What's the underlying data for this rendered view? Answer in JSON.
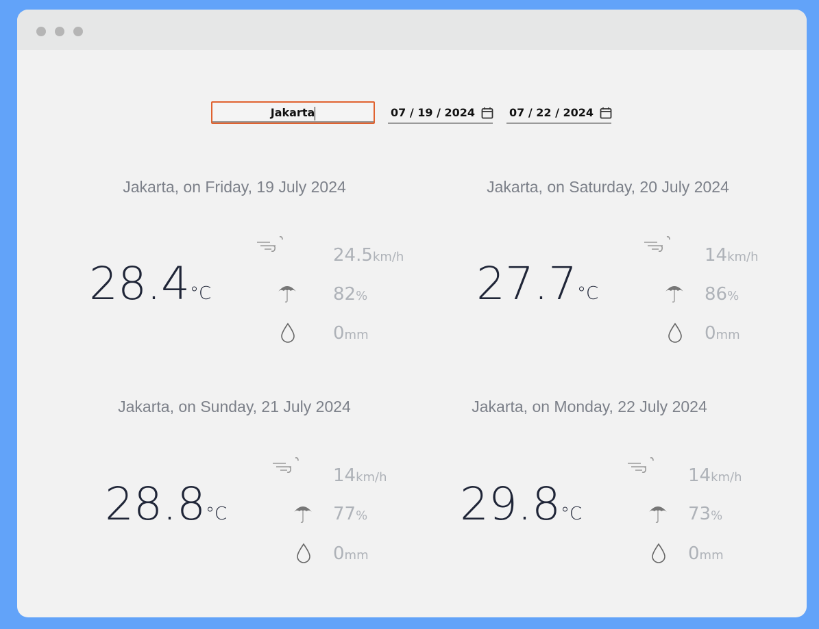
{
  "search": {
    "city": "Jakarta"
  },
  "dates": {
    "start": "07 / 19 / 2024",
    "end": "07 / 22 / 2024"
  },
  "forecasts": [
    {
      "title": "Jakarta, on Friday, 19 July 2024",
      "temp": "28.4",
      "temp_unit": "°C",
      "wind": "24.5",
      "wind_unit": "km/h",
      "humidity": "82",
      "humidity_unit": "%",
      "rain": "0",
      "rain_unit": "mm"
    },
    {
      "title": "Jakarta, on Saturday, 20 July 2024",
      "temp": "27.7",
      "temp_unit": "°C",
      "wind": "14",
      "wind_unit": "km/h",
      "humidity": "86",
      "humidity_unit": "%",
      "rain": "0",
      "rain_unit": "mm"
    },
    {
      "title": "Jakarta, on Sunday, 21 July 2024",
      "temp": "28.8",
      "temp_unit": "°C",
      "wind": "14",
      "wind_unit": "km/h",
      "humidity": "77",
      "humidity_unit": "%",
      "rain": "0",
      "rain_unit": "mm"
    },
    {
      "title": "Jakarta, on Monday, 22 July 2024",
      "temp": "29.8",
      "temp_unit": "°C",
      "wind": "14",
      "wind_unit": "km/h",
      "humidity": "73",
      "humidity_unit": "%",
      "rain": "0",
      "rain_unit": "mm"
    }
  ],
  "icons": {
    "wind": "wind-icon",
    "humidity": "umbrella-icon",
    "rain": "raindrop-icon",
    "calendar": "calendar-icon"
  },
  "colors": {
    "background": "#62a3f9",
    "focus_border": "#e0622f",
    "temp_text": "#1f2537",
    "muted_text": "#aeb2b8"
  }
}
